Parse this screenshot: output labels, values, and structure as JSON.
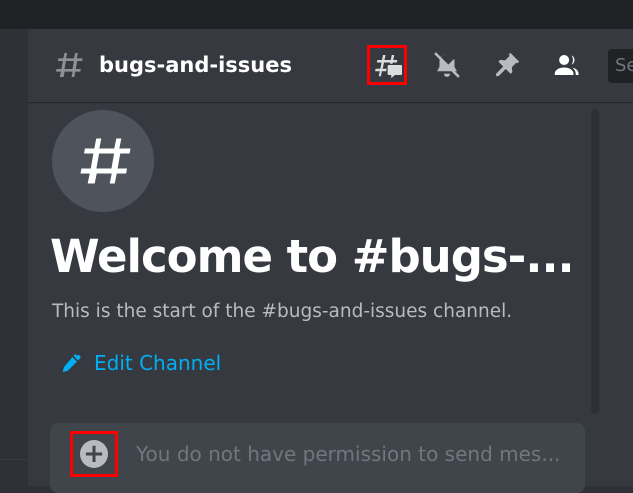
{
  "channel": {
    "name": "bugs-and-issues",
    "welcome_title": "Welcome to #bugs-...",
    "start_text": "This is the start of the #bugs-and-issues channel.",
    "edit_label": "Edit Channel"
  },
  "toolbar": {
    "search_placeholder": "Se",
    "icons": [
      "threads-icon",
      "notification-muted-icon",
      "pin-icon",
      "members-icon"
    ]
  },
  "composer": {
    "placeholder": "You do not have permission to send mes..."
  },
  "colors": {
    "background": "#36393f",
    "sidebar": "#2f3136",
    "titlebar": "#202225",
    "accent_link": "#00aff4",
    "highlight": "#ff0000"
  }
}
